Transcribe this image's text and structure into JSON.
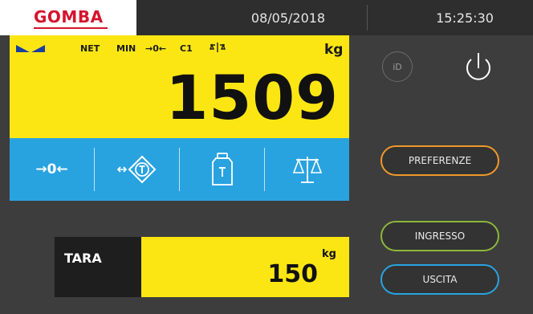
{
  "header": {
    "logo": "GOMBA",
    "date": "08/05/2018",
    "time": "15:25:30"
  },
  "weight": {
    "status": {
      "net": "NET",
      "min": "MIN",
      "zero": "→0←",
      "channel": "C1"
    },
    "unit": "kg",
    "value": "1509"
  },
  "functions": {
    "zero_label": "→0←"
  },
  "tare": {
    "label": "TARA",
    "value": "150",
    "unit": "kg"
  },
  "side": {
    "id_label": "iD",
    "preferences": "PREFERENZE",
    "entry": "INGRESSO",
    "exit": "USCITA"
  },
  "colors": {
    "yellow": "#fbe614",
    "blue": "#29a3e0",
    "orange": "#f0982a",
    "green": "#8ab83a",
    "brand_red": "#d4142e"
  }
}
